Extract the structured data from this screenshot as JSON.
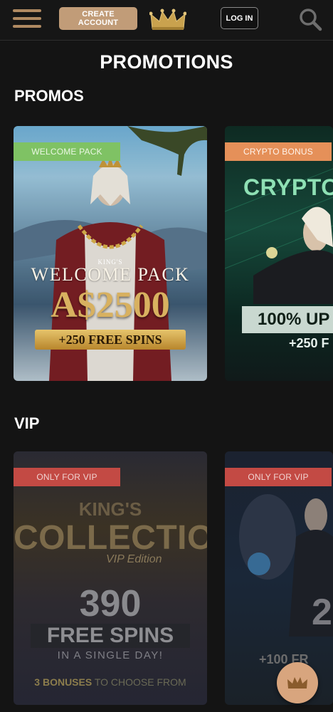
{
  "header": {
    "create_account_label": "CREATE ACCOUNT",
    "login_label": "LOG IN"
  },
  "page_title": "PROMOTIONS",
  "promos": {
    "title": "PROMOS",
    "cards": [
      {
        "tag": "WELCOME PACK",
        "tag_color": "#7fc264",
        "line1": "KING'S",
        "line2": "WELCOME PACK",
        "amount": "A$2500",
        "spins": "+250 FREE SPINS"
      },
      {
        "tag": "CRYPTO BONUS",
        "tag_color": "#e59059",
        "headline": "CRYPTO W",
        "percent": "100% UP",
        "spins": "+250 F"
      }
    ]
  },
  "vip": {
    "title": "VIP",
    "cards": [
      {
        "tag": "ONLY FOR VIP",
        "tag_color": "#c34a44",
        "line1": "KING'S",
        "line2": "COLLECTION",
        "edition": "VIP Edition",
        "number": "390",
        "free_spins": "FREE SPINS",
        "single_day": "IN A SINGLE DAY!",
        "bonuses_bold": "3 BONUSES",
        "bonuses_rest": "TO CHOOSE FROM"
      },
      {
        "tag": "ONLY FOR VIP",
        "tag_color": "#c34a44",
        "digit": "2",
        "spins": "+100 FR"
      }
    ]
  },
  "icons": {
    "menu": "hamburger-menu-icon",
    "logo": "crown-logo-icon",
    "search": "search-icon",
    "chip": "crown-icon"
  },
  "colors": {
    "accent": "#c19c78",
    "background": "#141414"
  }
}
